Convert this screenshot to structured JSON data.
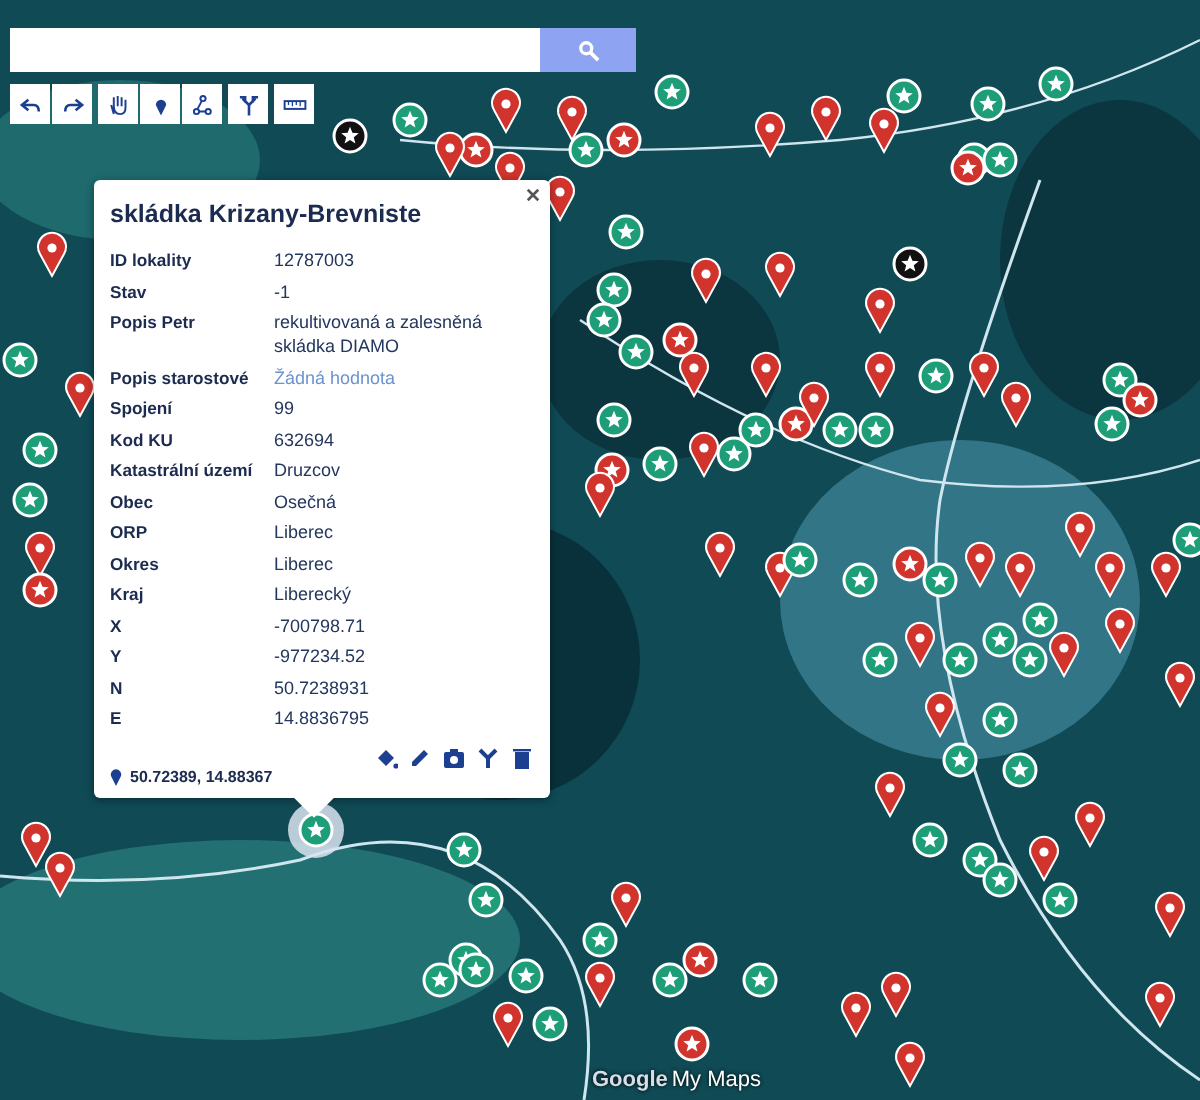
{
  "toolbar": [
    {
      "kind": "undo",
      "selected": false
    },
    {
      "kind": "redo",
      "selected": false
    },
    {
      "kind": "hand",
      "selected": false
    },
    {
      "kind": "marker",
      "selected": false
    },
    {
      "kind": "line",
      "selected": false
    },
    {
      "kind": "directions",
      "selected": false
    },
    {
      "kind": "ruler",
      "selected": false
    }
  ],
  "popup": {
    "title": "skládka Krizany-Brevniste",
    "rows": [
      {
        "label": "ID lokality",
        "value": "12787003",
        "empty": false
      },
      {
        "label": "Stav",
        "value": "-1",
        "empty": false
      },
      {
        "label": "Popis Petr",
        "value": "rekultivovaná a zalesněná skládka DIAMO",
        "empty": false
      },
      {
        "label": "Popis starostové",
        "value": "Žádná hodnota",
        "empty": true
      },
      {
        "label": "Spojení",
        "value": "99",
        "empty": false
      },
      {
        "label": "Kod KU",
        "value": "632694",
        "empty": false
      },
      {
        "label": "Katastrální území",
        "value": "Druzcov",
        "empty": false
      },
      {
        "label": "Obec",
        "value": "Osečná",
        "empty": false
      },
      {
        "label": "ORP",
        "value": "Liberec",
        "empty": false
      },
      {
        "label": "Okres",
        "value": "Liberec",
        "empty": false
      },
      {
        "label": "Kraj",
        "value": "Liberecký",
        "empty": false
      },
      {
        "label": "X",
        "value": "-700798.71",
        "empty": false
      },
      {
        "label": "Y",
        "value": "-977234.52",
        "empty": false
      },
      {
        "label": "N",
        "value": "50.7238931",
        "empty": false
      },
      {
        "label": "E",
        "value": "14.8836795",
        "empty": false
      }
    ],
    "coordinates": "50.72389, 14.88367",
    "actions": [
      {
        "kind": "style"
      },
      {
        "kind": "edit"
      },
      {
        "kind": "photo"
      },
      {
        "kind": "directions"
      },
      {
        "kind": "delete"
      }
    ]
  },
  "logo": {
    "brand": "Google",
    "product": "My Maps"
  }
}
